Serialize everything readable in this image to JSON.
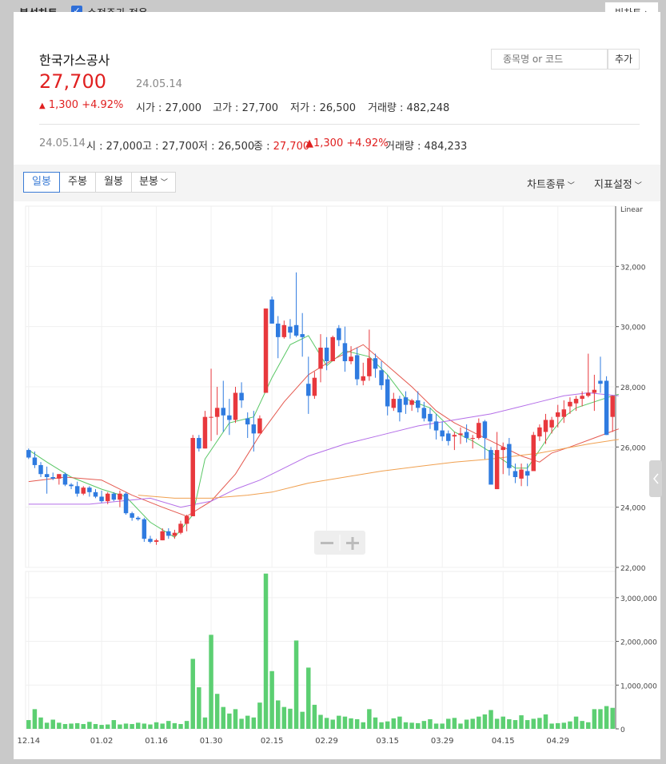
{
  "top": {
    "title": "분석차트",
    "adjusted_label": "수정주가 적용",
    "adjusted_checked": true,
    "bigchart": "빅차트 ›"
  },
  "stock": {
    "name": "한국가스공사",
    "price": "27,700",
    "date": "24.05.14",
    "change": "1,300",
    "change_pct": "+4.92%",
    "open_label": "시가",
    "open": "27,000",
    "high_label": "고가",
    "high": "27,700",
    "low_label": "저가",
    "low": "26,500",
    "volume_label": "거래량",
    "volume": "482,248"
  },
  "search": {
    "placeholder": "종목명 or 코드",
    "add_label": "추가"
  },
  "summary": {
    "date": "24.05.14",
    "o_label": "시",
    "o": "27,000",
    "h_label": "고",
    "h": "27,700",
    "l_label": "저",
    "l": "26,500",
    "c_label": "종",
    "c": "27,700",
    "change": "1,300",
    "change_pct": "+4.92%",
    "v_label": "거래량",
    "v": "484,233"
  },
  "toolbar": {
    "tabs": [
      {
        "label": "일봉",
        "active": true
      },
      {
        "label": "주봉"
      },
      {
        "label": "월봉"
      },
      {
        "label": "분봉"
      }
    ],
    "chart_type": "차트종류",
    "indicator": "지표설정"
  },
  "colors": {
    "up": "#e8383d",
    "down": "#2f7be0",
    "ma5": "#59c765",
    "ma20": "#e55a50",
    "ma60": "#b46ee8",
    "ma120": "#f0a050",
    "volume": "#5ccf72"
  },
  "chart_data": [
    {
      "type": "candlestick",
      "scale_label": "Linear",
      "y_ticks": [
        22000,
        24000,
        26000,
        28000,
        30000,
        32000
      ],
      "y_tick_labels": [
        "22,000",
        "24,000",
        "26,000",
        "28,000",
        "30,000",
        "32,000"
      ],
      "ylim": [
        22000,
        34000
      ],
      "x_ticks": [
        "12.14",
        "01.02",
        "01.16",
        "01.30",
        "02.15",
        "02.29",
        "03.15",
        "03.29",
        "04.15",
        "04.29"
      ],
      "x_tick_index": [
        0,
        12,
        21,
        30,
        40,
        49,
        59,
        68,
        78,
        87
      ],
      "candles": [
        [
          25900,
          25950,
          25600,
          25650
        ],
        [
          25650,
          25850,
          25300,
          25400
        ],
        [
          25400,
          25500,
          25000,
          25100
        ],
        [
          25100,
          25350,
          24450,
          25000
        ],
        [
          25000,
          25150,
          24900,
          24950
        ],
        [
          24950,
          25100,
          24750,
          25100
        ],
        [
          25100,
          25150,
          24700,
          24750
        ],
        [
          24750,
          24800,
          24600,
          24700
        ],
        [
          24700,
          24850,
          24350,
          24450
        ],
        [
          24450,
          24700,
          24400,
          24650
        ],
        [
          24650,
          24700,
          24350,
          24500
        ],
        [
          24500,
          24600,
          24300,
          24350
        ],
        [
          24350,
          24550,
          24150,
          24200
        ],
        [
          24200,
          24500,
          24100,
          24450
        ],
        [
          24450,
          24500,
          24200,
          24250
        ],
        [
          24250,
          24550,
          24000,
          24450
        ],
        [
          24450,
          24500,
          23750,
          23800
        ],
        [
          23800,
          23850,
          23550,
          23650
        ],
        [
          23650,
          23700,
          23550,
          23600
        ],
        [
          23600,
          23650,
          22850,
          22950
        ],
        [
          22950,
          23050,
          22800,
          22850
        ],
        [
          22850,
          22950,
          22750,
          22900
        ],
        [
          22900,
          23300,
          22900,
          23200
        ],
        [
          23200,
          23300,
          22950,
          23050
        ],
        [
          23050,
          23250,
          22950,
          23150
        ],
        [
          23150,
          23550,
          23100,
          23450
        ],
        [
          23450,
          23750,
          23200,
          23700
        ],
        [
          23700,
          26400,
          23700,
          26300
        ],
        [
          26300,
          26400,
          25850,
          25950
        ],
        [
          25950,
          27200,
          25950,
          27000
        ],
        [
          27000,
          28600,
          26200,
          27000
        ],
        [
          27000,
          28000,
          26400,
          27300
        ],
        [
          27300,
          28200,
          26500,
          27050
        ],
        [
          27050,
          27600,
          26400,
          26900
        ],
        [
          26900,
          28000,
          26800,
          27800
        ],
        [
          27800,
          28150,
          27300,
          27550
        ],
        [
          26950,
          27150,
          26300,
          26750
        ],
        [
          26750,
          27200,
          25850,
          26450
        ],
        [
          26450,
          27050,
          26500,
          26950
        ],
        [
          27800,
          30600,
          27800,
          30600
        ],
        [
          30900,
          31000,
          30100,
          30100
        ],
        [
          30100,
          30350,
          28950,
          29650
        ],
        [
          29650,
          30200,
          29600,
          30050
        ],
        [
          30000,
          30250,
          29600,
          29800
        ],
        [
          30050,
          31800,
          29650,
          29700
        ],
        [
          29750,
          30450,
          29000,
          29650
        ],
        [
          28100,
          29000,
          27100,
          27700
        ],
        [
          27700,
          28500,
          27600,
          28300
        ],
        [
          28600,
          29750,
          28150,
          29300
        ],
        [
          29300,
          29650,
          28550,
          28850
        ],
        [
          28850,
          29700,
          28850,
          29650
        ],
        [
          29950,
          30050,
          29350,
          29550
        ],
        [
          29450,
          30000,
          28500,
          28850
        ],
        [
          28850,
          29350,
          28750,
          29000
        ],
        [
          29050,
          29300,
          28050,
          28250
        ],
        [
          28200,
          28800,
          28050,
          28350
        ],
        [
          28350,
          29900,
          28200,
          28950
        ],
        [
          28950,
          29100,
          28300,
          28600
        ],
        [
          28550,
          28850,
          27900,
          28050
        ],
        [
          28250,
          28400,
          27050,
          27350
        ],
        [
          27300,
          27800,
          27200,
          27600
        ],
        [
          27600,
          27700,
          26850,
          27150
        ],
        [
          27650,
          27850,
          27100,
          27400
        ],
        [
          27400,
          27600,
          27200,
          27550
        ],
        [
          27550,
          27850,
          27150,
          27300
        ],
        [
          27300,
          27500,
          26850,
          26950
        ],
        [
          27100,
          27300,
          26600,
          26850
        ],
        [
          26850,
          27100,
          26250,
          26550
        ],
        [
          26550,
          26850,
          26200,
          26350
        ],
        [
          26450,
          26550,
          26050,
          26200
        ],
        [
          26350,
          26500,
          25900,
          26400
        ],
        [
          26400,
          26650,
          26100,
          26450
        ],
        [
          26500,
          26750,
          26150,
          26300
        ],
        [
          26300,
          26400,
          25950,
          26300
        ],
        [
          26300,
          26950,
          26250,
          26800
        ],
        [
          26850,
          26900,
          25600,
          26300
        ],
        [
          25900,
          26000,
          24800,
          24750
        ],
        [
          24600,
          26500,
          24600,
          25900
        ],
        [
          25900,
          26150,
          25100,
          26000
        ],
        [
          26100,
          26300,
          25050,
          25300
        ],
        [
          25200,
          25450,
          24800,
          25000
        ],
        [
          24950,
          25450,
          24700,
          25250
        ],
        [
          25200,
          25450,
          24700,
          25050
        ],
        [
          25200,
          26500,
          25300,
          26400
        ],
        [
          26350,
          26750,
          26200,
          26650
        ],
        [
          26500,
          27100,
          26100,
          26900
        ],
        [
          26650,
          27000,
          26450,
          26900
        ],
        [
          27000,
          27400,
          26650,
          27150
        ],
        [
          27000,
          27550,
          26800,
          27250
        ],
        [
          27350,
          27650,
          27100,
          27500
        ],
        [
          27450,
          27700,
          27200,
          27600
        ],
        [
          27600,
          27850,
          27350,
          27700
        ],
        [
          27700,
          29100,
          27650,
          27800
        ],
        [
          27800,
          28400,
          27200,
          27900
        ],
        [
          28200,
          29000,
          27800,
          28100
        ],
        [
          28200,
          28350,
          26400,
          26400
        ],
        [
          27000,
          27700,
          26500,
          27700
        ]
      ],
      "ma": [
        {
          "name": "5",
          "points": [
            [
              0,
              25900
            ],
            [
              3,
              25500
            ],
            [
              7,
              25000
            ],
            [
              12,
              24600
            ],
            [
              16,
              24350
            ],
            [
              20,
              23500
            ],
            [
              24,
              23000
            ],
            [
              27,
              23750
            ],
            [
              29,
              25600
            ],
            [
              33,
              26800
            ],
            [
              37,
              27000
            ],
            [
              40,
              28300
            ],
            [
              43,
              29400
            ],
            [
              46,
              29700
            ],
            [
              49,
              28700
            ],
            [
              52,
              29200
            ],
            [
              56,
              29000
            ],
            [
              59,
              28400
            ],
            [
              62,
              27600
            ],
            [
              66,
              27300
            ],
            [
              70,
              26500
            ],
            [
              73,
              26200
            ],
            [
              77,
              25700
            ],
            [
              80,
              25300
            ],
            [
              82,
              25300
            ],
            [
              84,
              25900
            ],
            [
              86,
              26500
            ],
            [
              88,
              27000
            ],
            [
              90,
              27300
            ],
            [
              93,
              27500
            ],
            [
              96,
              27700
            ],
            [
              97,
              27750
            ]
          ]
        },
        {
          "name": "20",
          "points": [
            [
              0,
              24850
            ],
            [
              6,
              25000
            ],
            [
              12,
              24900
            ],
            [
              17,
              24400
            ],
            [
              22,
              24000
            ],
            [
              26,
              23700
            ],
            [
              30,
              24200
            ],
            [
              34,
              25100
            ],
            [
              38,
              26400
            ],
            [
              42,
              27500
            ],
            [
              46,
              28400
            ],
            [
              50,
              28900
            ],
            [
              55,
              29400
            ],
            [
              59,
              28700
            ],
            [
              63,
              28000
            ],
            [
              67,
              27200
            ],
            [
              70,
              26800
            ],
            [
              74,
              26400
            ],
            [
              78,
              26000
            ],
            [
              81,
              25700
            ],
            [
              84,
              25500
            ],
            [
              86,
              25800
            ],
            [
              89,
              26000
            ],
            [
              93,
              26300
            ],
            [
              97,
              26600
            ]
          ]
        },
        {
          "name": "60",
          "points": [
            [
              0,
              24100
            ],
            [
              10,
              24100
            ],
            [
              15,
              24200
            ],
            [
              20,
              24300
            ],
            [
              25,
              24000
            ],
            [
              30,
              24200
            ],
            [
              34,
              24600
            ],
            [
              38,
              24900
            ],
            [
              42,
              25300
            ],
            [
              46,
              25700
            ],
            [
              52,
              26100
            ],
            [
              58,
              26400
            ],
            [
              64,
              26700
            ],
            [
              70,
              26900
            ],
            [
              76,
              27100
            ],
            [
              80,
              27300
            ],
            [
              84,
              27500
            ],
            [
              88,
              27700
            ],
            [
              92,
              27800
            ],
            [
              97,
              27700
            ]
          ]
        },
        {
          "name": "120",
          "points": [
            [
              18,
              24400
            ],
            [
              24,
              24300
            ],
            [
              30,
              24300
            ],
            [
              36,
              24400
            ],
            [
              40,
              24500
            ],
            [
              46,
              24800
            ],
            [
              52,
              25000
            ],
            [
              58,
              25200
            ],
            [
              64,
              25350
            ],
            [
              70,
              25500
            ],
            [
              76,
              25600
            ],
            [
              80,
              25700
            ],
            [
              84,
              25800
            ],
            [
              88,
              25950
            ],
            [
              92,
              26100
            ],
            [
              97,
              26250
            ]
          ]
        }
      ]
    },
    {
      "type": "bar",
      "title": "volume",
      "y_ticks": [
        0,
        1000000,
        2000000,
        3000000
      ],
      "y_tick_labels": [
        "0",
        "1,000,000",
        "2,000,000",
        "3,000,000"
      ],
      "ylim": [
        0,
        3600000
      ],
      "values": [
        200000,
        450000,
        260000,
        140000,
        210000,
        140000,
        110000,
        120000,
        130000,
        110000,
        160000,
        110000,
        90000,
        100000,
        200000,
        100000,
        120000,
        110000,
        140000,
        120000,
        100000,
        150000,
        120000,
        180000,
        130000,
        110000,
        180000,
        1600000,
        950000,
        260000,
        2150000,
        800000,
        500000,
        350000,
        450000,
        230000,
        300000,
        260000,
        600000,
        3550000,
        1320000,
        650000,
        500000,
        460000,
        2020000,
        390000,
        1400000,
        550000,
        320000,
        250000,
        210000,
        300000,
        280000,
        240000,
        220000,
        150000,
        450000,
        260000,
        150000,
        170000,
        240000,
        280000,
        150000,
        140000,
        130000,
        180000,
        220000,
        120000,
        120000,
        230000,
        250000,
        120000,
        210000,
        230000,
        280000,
        330000,
        430000,
        230000,
        280000,
        220000,
        200000,
        310000,
        200000,
        230000,
        250000,
        330000,
        120000,
        130000,
        140000,
        170000,
        280000,
        180000,
        150000,
        450000,
        450000,
        520000,
        480000
      ]
    }
  ]
}
